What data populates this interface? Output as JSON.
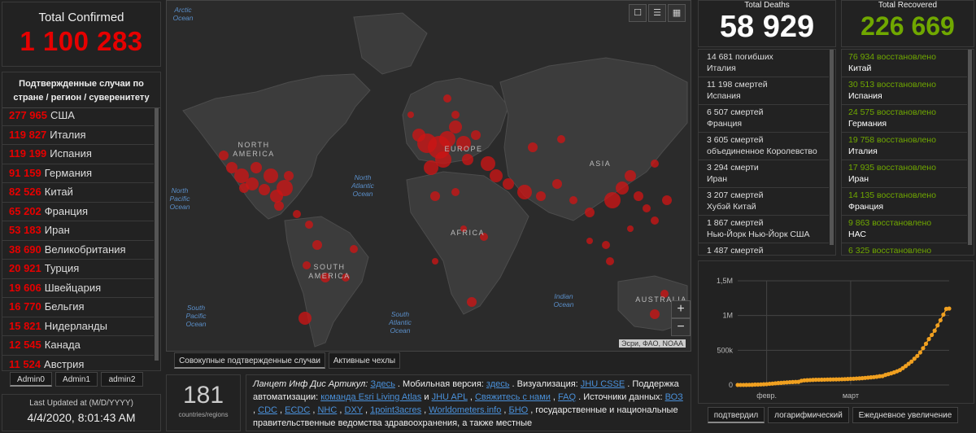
{
  "total_confirmed": {
    "label": "Total Confirmed",
    "value": "1 100 283"
  },
  "country_panel": {
    "header": "Подтвержденные случаи по стране / регион / суверенитету",
    "rows": [
      {
        "n": "277 965",
        "c": "США"
      },
      {
        "n": "119 827",
        "c": "Италия"
      },
      {
        "n": "119 199",
        "c": "Испания"
      },
      {
        "n": "91 159",
        "c": "Германия"
      },
      {
        "n": "82 526",
        "c": "Китай"
      },
      {
        "n": "65 202",
        "c": "Франция"
      },
      {
        "n": "53 183",
        "c": "Иран"
      },
      {
        "n": "38 690",
        "c": "Великобритания"
      },
      {
        "n": "20 921",
        "c": "Турция"
      },
      {
        "n": "19 606",
        "c": "Швейцария"
      },
      {
        "n": "16 770",
        "c": "Бельгия"
      },
      {
        "n": "15 821",
        "c": "Нидерланды"
      },
      {
        "n": "12 545",
        "c": "Канада"
      },
      {
        "n": "11 524",
        "c": "Австрия"
      }
    ]
  },
  "admin_tabs": [
    "Admin0",
    "Admin1",
    "admin2"
  ],
  "last_updated": {
    "label": "Last Updated at (M/D/YYYY)",
    "value": "4/4/2020, 8:01:43 AM"
  },
  "map": {
    "labels": {
      "na": "NORTH AMERICA",
      "sa": "SOUTH AMERICA",
      "eu": "EUROPE",
      "af": "AFRICA",
      "as": "ASIA",
      "au": "AUSTRALIA"
    },
    "oceans": {
      "arctic": "Arctic Ocean",
      "npac": "North Pacific Ocean",
      "natl": "North Atlantic Ocean",
      "spac": "South Pacific Ocean",
      "satl": "South Atlantic Ocean",
      "ind": "Indian Ocean"
    },
    "attribution": "Эсри, ФАО, NOAA",
    "zoom_in": "+",
    "zoom_out": "−",
    "tabs": [
      "Совокупные подтвержденные случаи",
      "Активные чехлы"
    ]
  },
  "countries_count": {
    "value": "181",
    "label": "countries/regions"
  },
  "info": {
    "line1_prefix": "Ланцет Инф Дис  Артикул: ",
    "here1": "Здесь",
    "mobile": " . Мобильная версия: ",
    "here2": "здесь",
    "viz": " . Визуализация: ",
    "jhu": "JHU CSSE",
    "support": " . Поддержка автоматизации: ",
    "esri": "команда Esri Living Atlas",
    "and": "  и ",
    "jhuapl": "JHU APL",
    "contact": "Свяжитесь с нами",
    "faq": "FAQ",
    "sources": " . Источники данных: ",
    "src": [
      "ВОЗ",
      "CDC",
      "ECDC",
      "NHC",
      "DXY",
      "1point3acres",
      "Worldometers.info",
      "БНО"
    ],
    "tail": " государственные и национальные правительственные ведомства здравоохранения, а также местные"
  },
  "deaths": {
    "label": "Total Deaths",
    "value": "58 929",
    "rows": [
      {
        "l1": "14 681  погибших",
        "l2": "Италия"
      },
      {
        "l1": "11 198  смертей",
        "l2": "Испания"
      },
      {
        "l1": "6 507  смертей",
        "l2": "Франция"
      },
      {
        "l1": "3 605  смертей",
        "l2": "объединенное Королевство"
      },
      {
        "l1": "3 294  смерти",
        "l2": "Иран"
      },
      {
        "l1": "3 207  смертей",
        "l2": "Хубэй  Китай"
      },
      {
        "l1": "1 867  смертей",
        "l2": "Нью-Йорк  Нью-Йорк  США"
      },
      {
        "l1": "1 487  смертей",
        "l2": ""
      }
    ]
  },
  "recovered": {
    "label": "Total Recovered",
    "value": "226 669",
    "rows": [
      {
        "n": "76 934 восстановлено",
        "c": "Китай"
      },
      {
        "n": "30 513 восстановлено",
        "c": "Испания"
      },
      {
        "n": "24 575 восстановлено",
        "c": "Германия"
      },
      {
        "n": "19 758 восстановлено",
        "c": "Италия"
      },
      {
        "n": "17 935 восстановлено",
        "c": "Иран"
      },
      {
        "n": "14 135 восстановлено",
        "c": "Франция"
      },
      {
        "n": "9 863 восстановлено",
        "c": "НАС"
      },
      {
        "n": "6 325 восстановлено",
        "c": ""
      }
    ]
  },
  "chart_tabs": [
    "подтвердил",
    "логарифмический",
    "Ежедневное увеличение"
  ],
  "chart_data": {
    "type": "line",
    "x_tick_labels": [
      "февр.",
      "март"
    ],
    "y_tick_labels": [
      "0",
      "500k",
      "1M",
      "1,5M"
    ],
    "ylim": [
      0,
      1500000
    ],
    "color": "#f0a020",
    "values": [
      555,
      654,
      941,
      1434,
      2118,
      2927,
      5578,
      6166,
      8234,
      9927,
      12038,
      16787,
      19881,
      23892,
      27635,
      30794,
      34391,
      37120,
      40150,
      42762,
      44802,
      45221,
      60368,
      66885,
      69030,
      71224,
      73258,
      75136,
      75639,
      76197,
      76819,
      78572,
      78958,
      79561,
      80406,
      81388,
      82746,
      84112,
      86011,
      88369,
      90306,
      92840,
      95120,
      97886,
      101801,
      105847,
      109821,
      113590,
      118620,
      125875,
      128352,
      145205,
      156101,
      167454,
      181574,
      197102,
      214821,
      242570,
      272208,
      304507,
      336953,
      378235,
      418045,
      467653,
      529591,
      593291,
      660706,
      720117,
      782365,
      857487,
      932605,
      1013157,
      1095917,
      1100283
    ]
  },
  "colors": {
    "confirmed": "#e60000",
    "recovered": "#70a800",
    "map_bubble": "#cc1414",
    "link": "#4a90d9"
  }
}
